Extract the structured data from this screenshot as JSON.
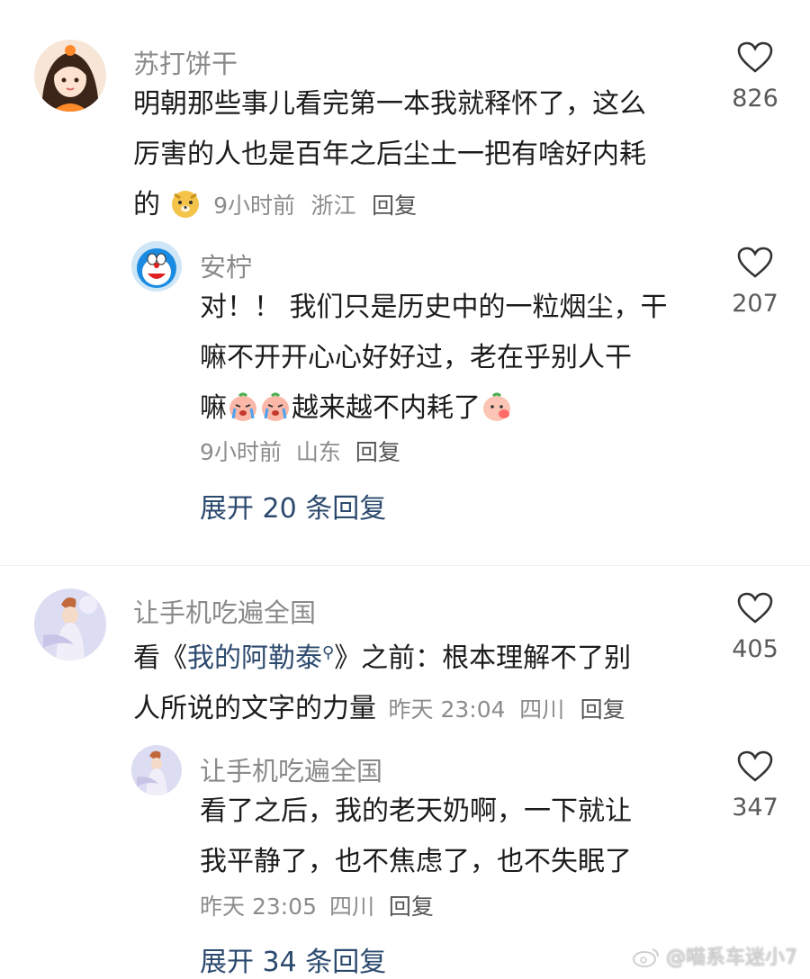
{
  "comments": [
    {
      "username": "苏打饼干",
      "text_line1": "明朝那些事儿看完第一本我就释怀了，这么",
      "text_line2": "厉害的人也是百年之后尘土一把有啥好内耗",
      "text_line3": "的",
      "time": "9小时前",
      "location": "浙江",
      "reply_label": "回复",
      "likes": "826",
      "avatar_icon": "girl-with-orange-avatar",
      "reply": {
        "username": "安柠",
        "text_line1": "对！！ 我们只是历史中的一粒烟尘，干",
        "text_line2": "嘛不开开心心好好过，老在乎别人干",
        "text_line3a": "嘛",
        "text_line3b": "越来越不内耗了",
        "time": "9小时前",
        "location": "山东",
        "reply_label": "回复",
        "likes": "207",
        "avatar_icon": "doraemon-avatar"
      },
      "expand_label": "展开 20 条回复"
    },
    {
      "username": "让手机吃遍全国",
      "text_pre": "看《",
      "text_link": "我的阿勒泰",
      "text_post": "》之前：根本理解不了别",
      "text_line2": "人所说的文字的力量",
      "time": "昨天 23:04",
      "location": "四川",
      "reply_label": "回复",
      "likes": "405",
      "avatar_icon": "anime-character-avatar",
      "reply": {
        "username": "让手机吃遍全国",
        "text_line1": "看了之后，我的老天奶啊，一下就让",
        "text_line2": "我平静了，也不焦虑了，也不失眠了",
        "time": "昨天 23:05",
        "location": "四川",
        "reply_label": "回复",
        "likes": "347",
        "avatar_icon": "anime-character-avatar"
      },
      "expand_label": "展开 34 条回复"
    }
  ],
  "watermark": "@喵系车迷小7",
  "colors": {
    "username": "#8a8a8a",
    "text": "#1c1c1c",
    "meta": "#8c8c8c",
    "expand": "#2c4a6e"
  }
}
